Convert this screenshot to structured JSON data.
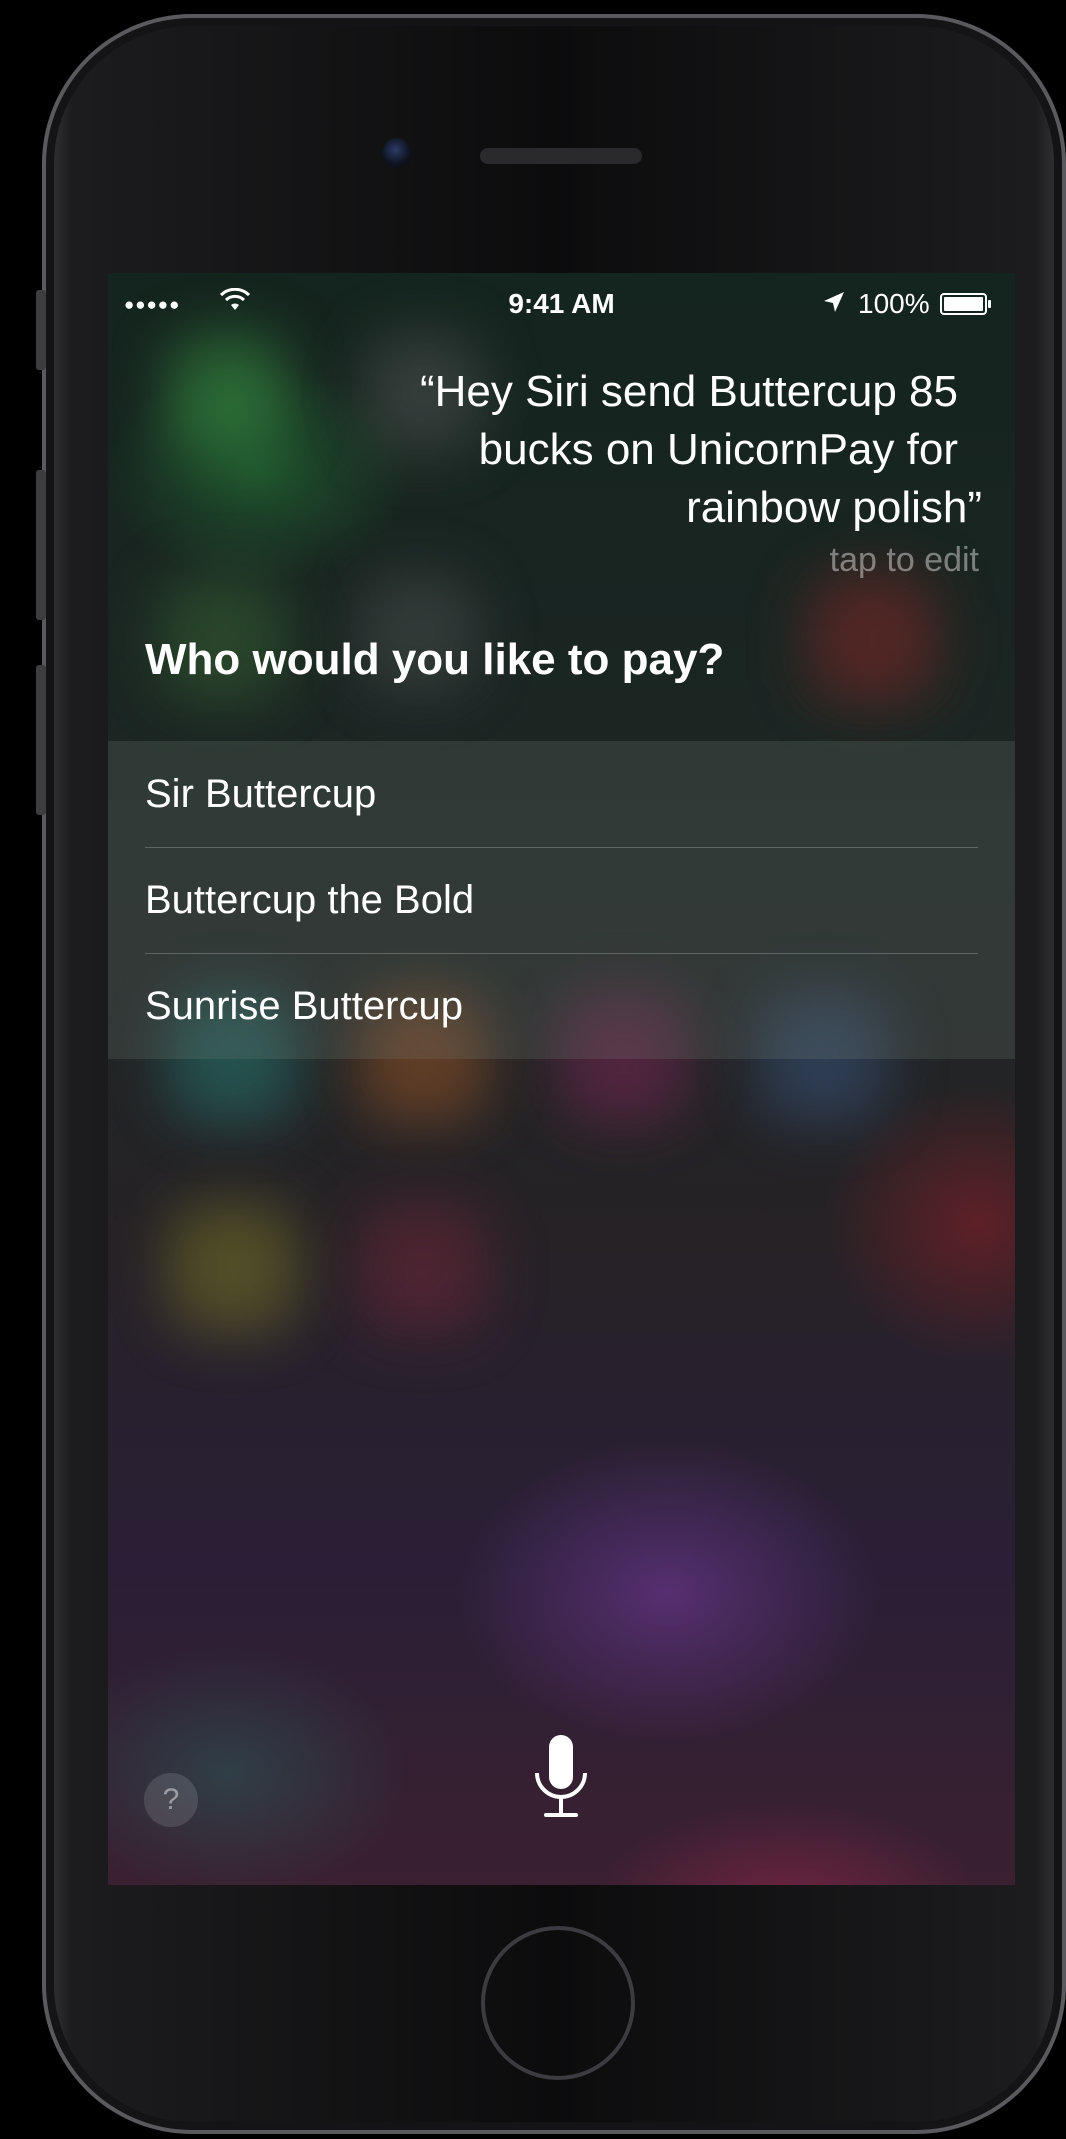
{
  "status_bar": {
    "signal": "●●●●●",
    "time": "9:41 AM",
    "battery": "100%"
  },
  "siri": {
    "utterance_line1": "“Hey Siri send Buttercup 85",
    "utterance_line2": "bucks on UnicornPay for",
    "utterance_line3": "rainbow polish”",
    "tap_to_edit": "tap to edit",
    "question": "Who would you like to pay?",
    "options": [
      {
        "label": "Sir Buttercup"
      },
      {
        "label": "Buttercup the Bold"
      },
      {
        "label": "Sunrise Buttercup"
      }
    ],
    "help": "?"
  },
  "icons": {
    "wifi": "wifi-icon",
    "location": "location-arrow-icon",
    "battery": "battery-full-icon",
    "mic": "microphone-icon",
    "help": "question-mark-icon"
  }
}
